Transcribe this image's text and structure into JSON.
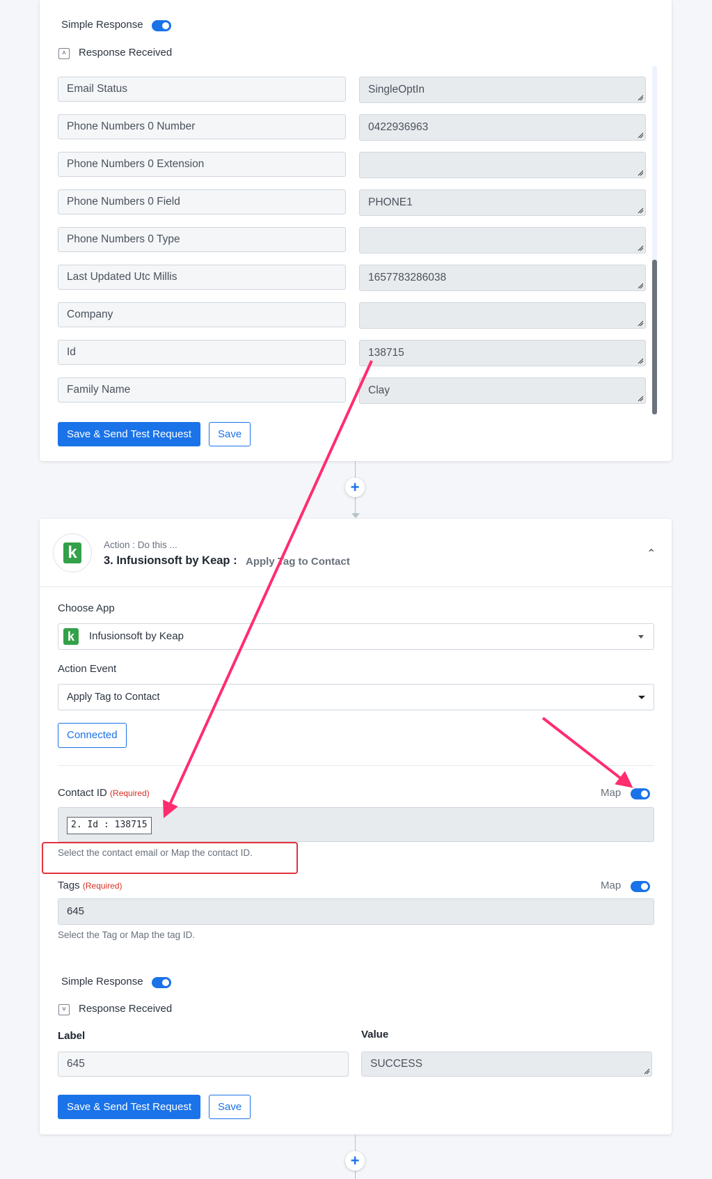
{
  "card1": {
    "simple_response_label": "Simple Response",
    "response_received_label": "Response Received",
    "rows": [
      {
        "label": "Email Status",
        "value": "SingleOptIn"
      },
      {
        "label": "Phone Numbers 0 Number",
        "value": "0422936963"
      },
      {
        "label": "Phone Numbers 0 Extension",
        "value": ""
      },
      {
        "label": "Phone Numbers 0 Field",
        "value": "PHONE1"
      },
      {
        "label": "Phone Numbers 0 Type",
        "value": ""
      },
      {
        "label": "Last Updated Utc Millis",
        "value": "1657783286038"
      },
      {
        "label": "Company",
        "value": ""
      },
      {
        "label": "Id",
        "value": "138715"
      },
      {
        "label": "Family Name",
        "value": "Clay"
      }
    ],
    "save_send_label": "Save & Send Test Request",
    "save_label": "Save"
  },
  "card2": {
    "action_subtitle": "Action : Do this ...",
    "step_title": "3. Infusionsoft by Keap :",
    "step_event": "Apply Tag to Contact",
    "choose_app_label": "Choose App",
    "app_value": "Infusionsoft by Keap",
    "logo_letter": "k",
    "action_event_label": "Action Event",
    "action_event_value": "Apply Tag to Contact",
    "connected_label": "Connected",
    "contact_id_label": "Contact ID",
    "required_label": "(Required)",
    "map_label": "Map",
    "contact_id_chip": "2. Id : 138715",
    "contact_id_help": "Select the contact email or Map the contact ID.",
    "tags_label": "Tags",
    "tags_value": "645",
    "tags_help": "Select the Tag or Map the tag ID.",
    "simple_response_label": "Simple Response",
    "response_received_label": "Response Received",
    "col_label": "Label",
    "col_value": "Value",
    "result_label": "645",
    "result_value": "SUCCESS",
    "save_send_label": "Save & Send Test Request",
    "save_label": "Save"
  },
  "colors": {
    "primary": "#1a73e8",
    "annotation": "#ff2d6f",
    "highlight_box": "#e0323c",
    "keap_green": "#33a14a"
  }
}
